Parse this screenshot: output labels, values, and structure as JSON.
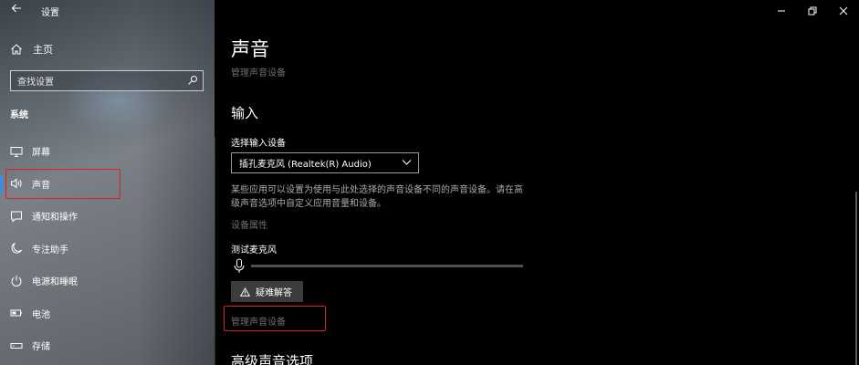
{
  "window": {
    "title": "设置",
    "controls": {
      "minimize": "minimize-icon",
      "restore": "restore-icon",
      "close": "close-icon"
    }
  },
  "sidebar": {
    "home_label": "主页",
    "search_placeholder": "查找设置",
    "section_heading": "系统",
    "items": [
      {
        "label": "屏幕",
        "icon": "display-icon",
        "selected": false
      },
      {
        "label": "声音",
        "icon": "speaker-icon",
        "selected": true
      },
      {
        "label": "通知和操作",
        "icon": "notification-icon",
        "selected": false
      },
      {
        "label": "专注助手",
        "icon": "moon-icon",
        "selected": false
      },
      {
        "label": "电源和睡眠",
        "icon": "power-icon",
        "selected": false
      },
      {
        "label": "电池",
        "icon": "battery-icon",
        "selected": false
      },
      {
        "label": "存储",
        "icon": "storage-icon",
        "selected": false
      }
    ]
  },
  "main": {
    "title": "声音",
    "manage_devices_top": "管理声音设备",
    "input_heading": "输入",
    "select_input_label": "选择输入设备",
    "selected_input_device": "插孔麦克风 (Realtek(R) Audio)",
    "description_lines": [
      "某些应用可以设置为使用与此处选择的声音设备不同的声音设备。请在高",
      "级声音选项中自定义应用音量和设备。"
    ],
    "device_properties_link": "设备属性",
    "test_mic_label": "测试麦克风",
    "mic_level": 0,
    "troubleshoot_label": "疑难解答",
    "manage_devices_link": "管理声音设备",
    "advanced_heading": "高级声音选项"
  },
  "colors": {
    "accent": "#3a8de6",
    "highlight_box": "#d9231f",
    "link": "#6b6f74"
  }
}
